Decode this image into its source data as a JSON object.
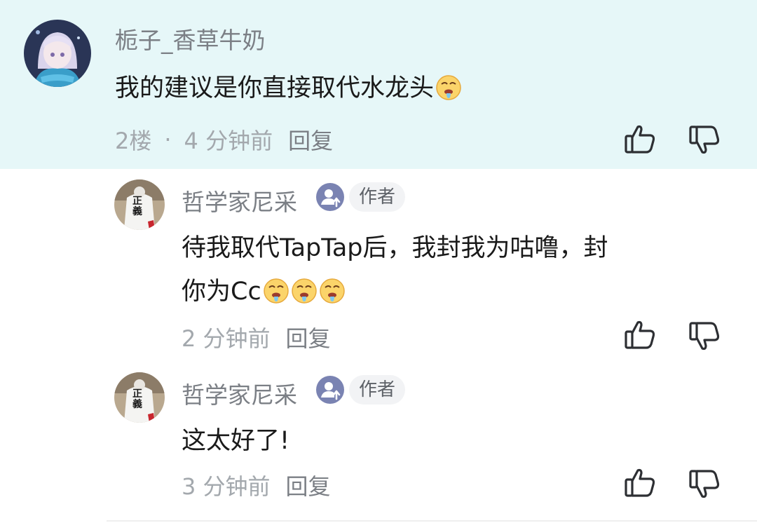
{
  "main_comment": {
    "username": "栀子_香草牛奶",
    "content": "我的建议是你直接取代水龙头",
    "floor": "2楼",
    "separator": "·",
    "time": "4 分钟前",
    "reply_label": "回复"
  },
  "replies": [
    {
      "username": "哲学家尼采",
      "badge": "作者",
      "content_line1": "待我取代TapTap后，我封我为咕噜，封",
      "content_line2": "你为Cc",
      "time": "2 分钟前",
      "reply_label": "回复"
    },
    {
      "username": "哲学家尼采",
      "badge": "作者",
      "content_line1": "这太好了!",
      "time": "3 分钟前",
      "reply_label": "回复"
    }
  ],
  "avatar_text": "正義",
  "icons": {
    "like": "thumbs-up-icon",
    "dislike": "thumbs-down-icon",
    "emoji": "drooling-face-emoji",
    "author_badge": "author-upload-icon"
  },
  "colors": {
    "highlight_bg": "#e6f7f8",
    "badge_bg": "#7a83b2",
    "meta_text": "#a3a8ad"
  }
}
